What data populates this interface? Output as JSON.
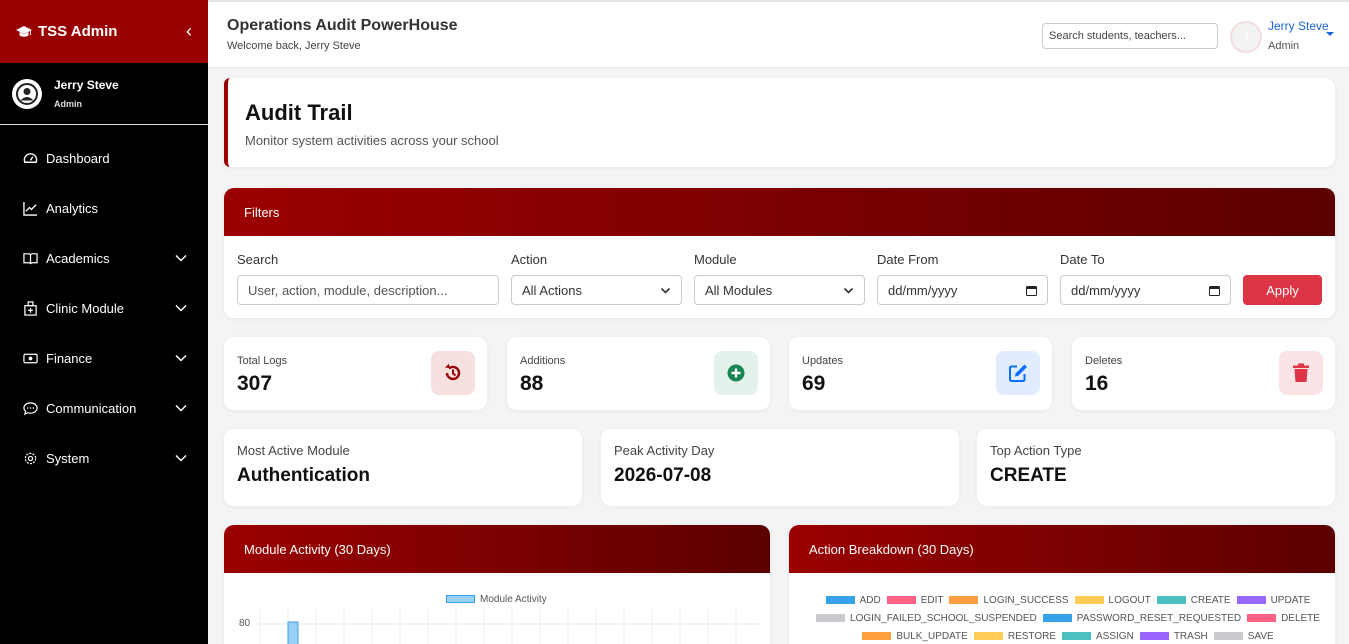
{
  "sidebar": {
    "brand": "TSS Admin",
    "user": {
      "name": "Jerry Steve",
      "role": "Admin"
    },
    "items": [
      {
        "label": "Dashboard",
        "icon": "gauge-icon"
      },
      {
        "label": "Analytics",
        "icon": "chart-line-icon"
      },
      {
        "label": "Academics",
        "icon": "book-icon"
      },
      {
        "label": "Clinic Module",
        "icon": "clinic-icon"
      },
      {
        "label": "Finance",
        "icon": "money-icon"
      },
      {
        "label": "Communication",
        "icon": "chat-icon"
      },
      {
        "label": "System",
        "icon": "gear-icon"
      }
    ]
  },
  "topbar": {
    "title": "Operations Audit PowerHouse",
    "welcome": "Welcome back, Jerry Steve",
    "search_placeholder": "Search students, teachers...",
    "avatar_letter": "J",
    "user_name": "Jerry Steve",
    "user_role": "Admin"
  },
  "page": {
    "title": "Audit Trail",
    "subtitle": "Monitor system activities across your school"
  },
  "filters": {
    "heading": "Filters",
    "search_label": "Search",
    "search_placeholder": "User, action, module, description...",
    "action_label": "Action",
    "action_value": "All Actions",
    "module_label": "Module",
    "module_value": "All Modules",
    "date_from_label": "Date From",
    "date_from_value": "dd/mm/yyyy",
    "date_to_label": "Date To",
    "date_to_value": "dd/mm/yyyy",
    "apply_label": "Apply"
  },
  "stats": [
    {
      "label": "Total Logs",
      "value": "307",
      "icon": "history-icon",
      "color": "#990000",
      "bg": "#f6e0e0"
    },
    {
      "label": "Additions",
      "value": "88",
      "icon": "plus-circle-icon",
      "color": "#198754",
      "bg": "#e3f2ea"
    },
    {
      "label": "Updates",
      "value": "69",
      "icon": "edit-icon",
      "color": "#0d6efd",
      "bg": "#e1edff"
    },
    {
      "label": "Deletes",
      "value": "16",
      "icon": "trash-icon",
      "color": "#dc3545",
      "bg": "#fbe4e6"
    }
  ],
  "insights": [
    {
      "label": "Most Active Module",
      "value": "Authentication"
    },
    {
      "label": "Peak Activity Day",
      "value": "2026-07-08"
    },
    {
      "label": "Top Action Type",
      "value": "CREATE"
    }
  ],
  "charts": {
    "module_activity": {
      "title": "Module Activity (30 Days)",
      "legend": "Module Activity",
      "y_tick": "80"
    },
    "action_breakdown": {
      "title": "Action Breakdown (30 Days)",
      "legend": [
        {
          "label": "ADD",
          "color": "#36a2eb"
        },
        {
          "label": "EDIT",
          "color": "#ff6384"
        },
        {
          "label": "LOGIN_SUCCESS",
          "color": "#ff9f40"
        },
        {
          "label": "LOGOUT",
          "color": "#ffcd56"
        },
        {
          "label": "CREATE",
          "color": "#4bc0c0"
        },
        {
          "label": "UPDATE",
          "color": "#9966ff"
        },
        {
          "label": "LOGIN_FAILED_SCHOOL_SUSPENDED",
          "color": "#c9cbcf"
        },
        {
          "label": "PASSWORD_RESET_REQUESTED",
          "color": "#36a2eb"
        },
        {
          "label": "DELETE",
          "color": "#ff6384"
        },
        {
          "label": "BULK_UPDATE",
          "color": "#ff9f40"
        },
        {
          "label": "RESTORE",
          "color": "#ffcd56"
        },
        {
          "label": "ASSIGN",
          "color": "#4bc0c0"
        },
        {
          "label": "TRASH",
          "color": "#9966ff"
        },
        {
          "label": "SAVE",
          "color": "#c9cbcf"
        }
      ]
    }
  }
}
